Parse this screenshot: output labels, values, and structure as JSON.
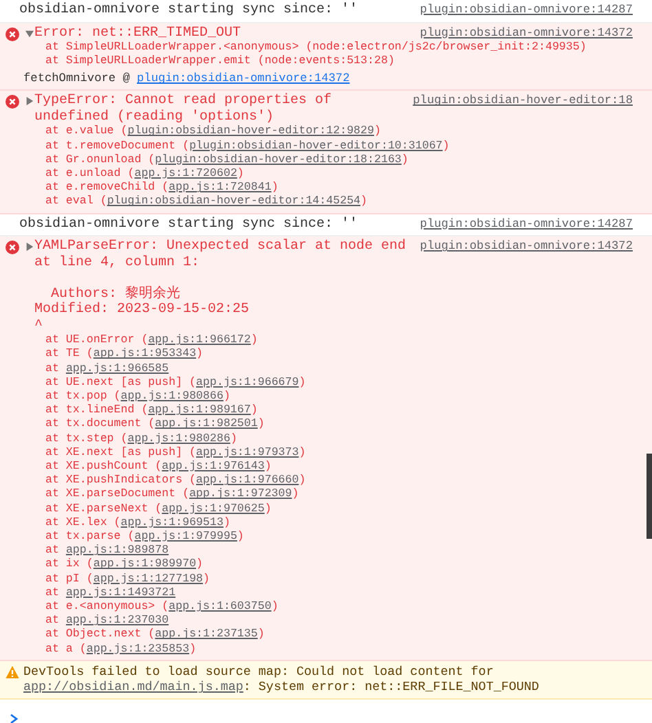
{
  "messages": [
    {
      "kind": "log",
      "text": "obsidian-omnivore starting sync since: ''",
      "source": "plugin:obsidian-omnivore:14287"
    },
    {
      "kind": "error",
      "expanded": true,
      "text": "Error: net::ERR_TIMED_OUT",
      "source": "plugin:obsidian-omnivore:14372",
      "frames": [
        {
          "text": "at SimpleURLLoaderWrapper.<anonymous> (node:electron/js2c/browser_init:2:49935)"
        },
        {
          "text": "at SimpleURLLoaderWrapper.emit (node:events:513:28)"
        }
      ],
      "call_site": {
        "func": "fetchOmnivore @",
        "link": "plugin:obsidian-omnivore:14372"
      }
    },
    {
      "kind": "error",
      "expanded": false,
      "text": "TypeError: Cannot read properties of undefined (reading 'options')",
      "source": "plugin:obsidian-hover-editor:18",
      "frames": [
        {
          "text": "at e.value (",
          "link": "plugin:obsidian-hover-editor:12:9829",
          "text_after": ")"
        },
        {
          "text": "at t.removeDocument (",
          "link": "plugin:obsidian-hover-editor:10:31067",
          "text_after": ")"
        },
        {
          "text": "at Gr.onunload (",
          "link": "plugin:obsidian-hover-editor:18:2163",
          "text_after": ")"
        },
        {
          "text": "at e.unload (",
          "link": "app.js:1:720602",
          "text_after": ")"
        },
        {
          "text": "at e.removeChild (",
          "link": "app.js:1:720841",
          "text_after": ")"
        },
        {
          "text": "at eval (",
          "link": "plugin:obsidian-hover-editor:14:45254",
          "text_after": ")"
        }
      ]
    },
    {
      "kind": "log",
      "text": "obsidian-omnivore starting sync since: ''",
      "source": "plugin:obsidian-omnivore:14287"
    },
    {
      "kind": "error",
      "expanded": false,
      "text": "YAMLParseError: Unexpected scalar at node end at line 4, column 1:\n\n  Authors: 黎明余光\nModified: 2023-09-15-02:25\n^",
      "source": "plugin:obsidian-omnivore:14372",
      "frames": [
        {
          "text": "at UE.onError (",
          "link": "app.js:1:966172",
          "text_after": ")"
        },
        {
          "text": "at TE (",
          "link": "app.js:1:953343",
          "text_after": ")"
        },
        {
          "text": "at ",
          "link": "app.js:1:966585"
        },
        {
          "text": "at UE.next [as push] (",
          "link": "app.js:1:966679",
          "text_after": ")"
        },
        {
          "text": "at tx.pop (",
          "link": "app.js:1:980866",
          "text_after": ")"
        },
        {
          "text": "at tx.lineEnd (",
          "link": "app.js:1:989167",
          "text_after": ")"
        },
        {
          "text": "at tx.document (",
          "link": "app.js:1:982501",
          "text_after": ")"
        },
        {
          "text": "at tx.step (",
          "link": "app.js:1:980286",
          "text_after": ")"
        },
        {
          "text": "at XE.next [as push] (",
          "link": "app.js:1:979373",
          "text_after": ")"
        },
        {
          "text": "at XE.pushCount (",
          "link": "app.js:1:976143",
          "text_after": ")"
        },
        {
          "text": "at XE.pushIndicators (",
          "link": "app.js:1:976660",
          "text_after": ")"
        },
        {
          "text": "at XE.parseDocument (",
          "link": "app.js:1:972309",
          "text_after": ")"
        },
        {
          "text": "at XE.parseNext (",
          "link": "app.js:1:970625",
          "text_after": ")"
        },
        {
          "text": "at XE.lex (",
          "link": "app.js:1:969513",
          "text_after": ")"
        },
        {
          "text": "at tx.parse (",
          "link": "app.js:1:979995",
          "text_after": ")"
        },
        {
          "text": "at ",
          "link": "app.js:1:989878"
        },
        {
          "text": "at ix (",
          "link": "app.js:1:989970",
          "text_after": ")"
        },
        {
          "text": "at pI (",
          "link": "app.js:1:1277198",
          "text_after": ")"
        },
        {
          "text": "at ",
          "link": "app.js:1:1493721"
        },
        {
          "text": "at e.<anonymous> (",
          "link": "app.js:1:603750",
          "text_after": ")"
        },
        {
          "text": "at ",
          "link": "app.js:1:237030"
        },
        {
          "text": "at Object.next (",
          "link": "app.js:1:237135",
          "text_after": ")"
        },
        {
          "text": "at a (",
          "link": "app.js:1:235853",
          "text_after": ")"
        }
      ]
    },
    {
      "kind": "warning",
      "text": "DevTools failed to load source map: Could not load content for ",
      "link": "app://obsidian.md/main.js.map",
      "text_after": ": System error: net::ERR_FILE_NOT_FOUND"
    }
  ]
}
